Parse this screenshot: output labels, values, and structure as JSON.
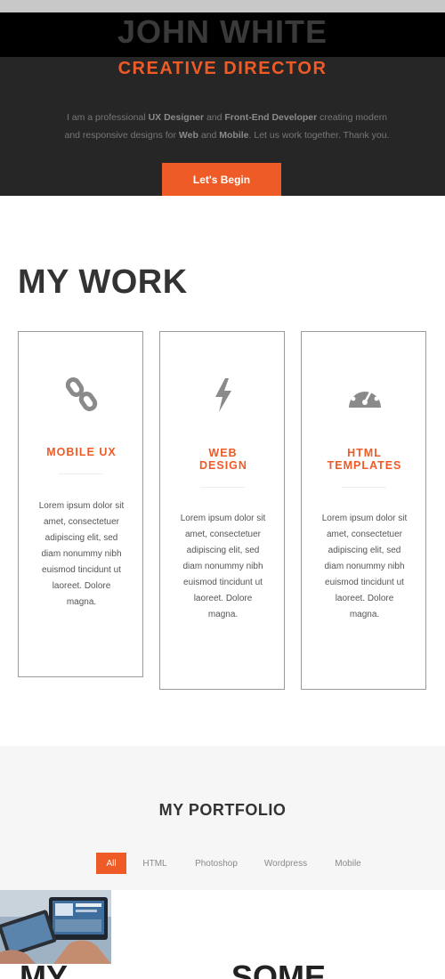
{
  "hero": {
    "name": "JOHN WHITE",
    "role": "CREATIVE DIRECTOR",
    "intro": {
      "p1": "I am a professional ",
      "b1": "UX Designer",
      "p2": " and ",
      "b2": "Front-End Developer",
      "p3": " creating modern and responsive designs for ",
      "b3": "Web",
      "p4": " and ",
      "b4": "Mobile",
      "p5": ". Let us work together. Thank you."
    },
    "cta": "Let's Begin"
  },
  "work": {
    "title_a": "MY ",
    "title_b": "WORK",
    "cards": [
      {
        "icon": "link-icon",
        "title": "MOBILE UX",
        "desc": "Lorem ipsum dolor sit amet, consectetuer adipiscing elit, sed diam nonummy nibh euismod tincidunt ut laoreet. Dolore magna."
      },
      {
        "icon": "lightning-icon",
        "title": "WEB DESIGN",
        "desc": "Lorem ipsum dolor sit amet, consectetuer adipiscing elit, sed diam nonummy nibh euismod tincidunt ut laoreet. Dolore magna."
      },
      {
        "icon": "dashboard-icon",
        "title": "HTML TEMPLATES",
        "desc": "Lorem ipsum dolor sit amet, consectetuer adipiscing elit, sed diam nonummy nibh euismod tincidunt ut laoreet. Dolore magna."
      }
    ]
  },
  "portfolio": {
    "title_a": "MY ",
    "title_b": "PORTFOLIO",
    "filters": [
      "All",
      "HTML",
      "Photoshop",
      "Wordpress",
      "Mobile"
    ],
    "active_filter": "All"
  },
  "bottom": {
    "left_heading": "MY",
    "right_heading": "SOME"
  },
  "colors": {
    "accent": "#ef5b26",
    "hero_bg": "#262626",
    "portfolio_bg": "#f6f6f6"
  }
}
